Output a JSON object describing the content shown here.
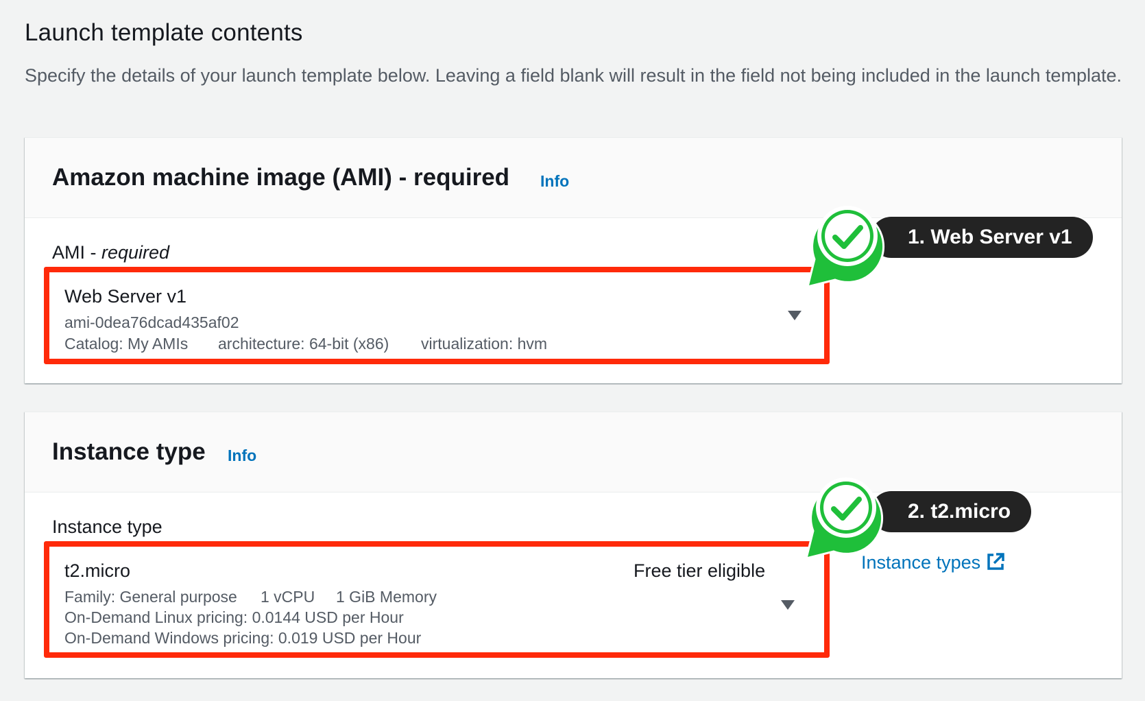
{
  "header": {
    "title": "Launch template contents",
    "description": "Specify the details of your launch template below. Leaving a field blank will result in the field not being included in the launch template."
  },
  "ami_panel": {
    "title": "Amazon machine image (AMI) - required",
    "info": "Info",
    "field_label": "AMI - ",
    "field_label_italic": "required",
    "selected": {
      "name": "Web Server v1",
      "id": "ami-0dea76dcad435af02",
      "catalog": "Catalog: My AMIs",
      "architecture": "architecture: 64-bit (x86)",
      "virtualization": "virtualization: hvm"
    },
    "callout": "1. Web Server v1"
  },
  "instance_panel": {
    "title": "Instance type",
    "info": "Info",
    "field_label": "Instance type",
    "selected": {
      "name": "t2.micro",
      "badge": "Free tier eligible",
      "family": "Family: General purpose",
      "vcpu": "1 vCPU",
      "memory": "1 GiB Memory",
      "linux_pricing": "On-Demand Linux pricing: 0.0144 USD per Hour",
      "windows_pricing": "On-Demand Windows pricing: 0.019 USD per Hour"
    },
    "callout": "2. t2.micro",
    "instance_types_link": "Instance types"
  },
  "icons": {
    "check": "check-icon",
    "caret": "caret-down-icon",
    "external": "external-link-icon"
  },
  "colors": {
    "highlight": "#ff2a0a",
    "check_green": "#1fbf3a",
    "link": "#0073bb",
    "callout_bg": "#232323"
  }
}
